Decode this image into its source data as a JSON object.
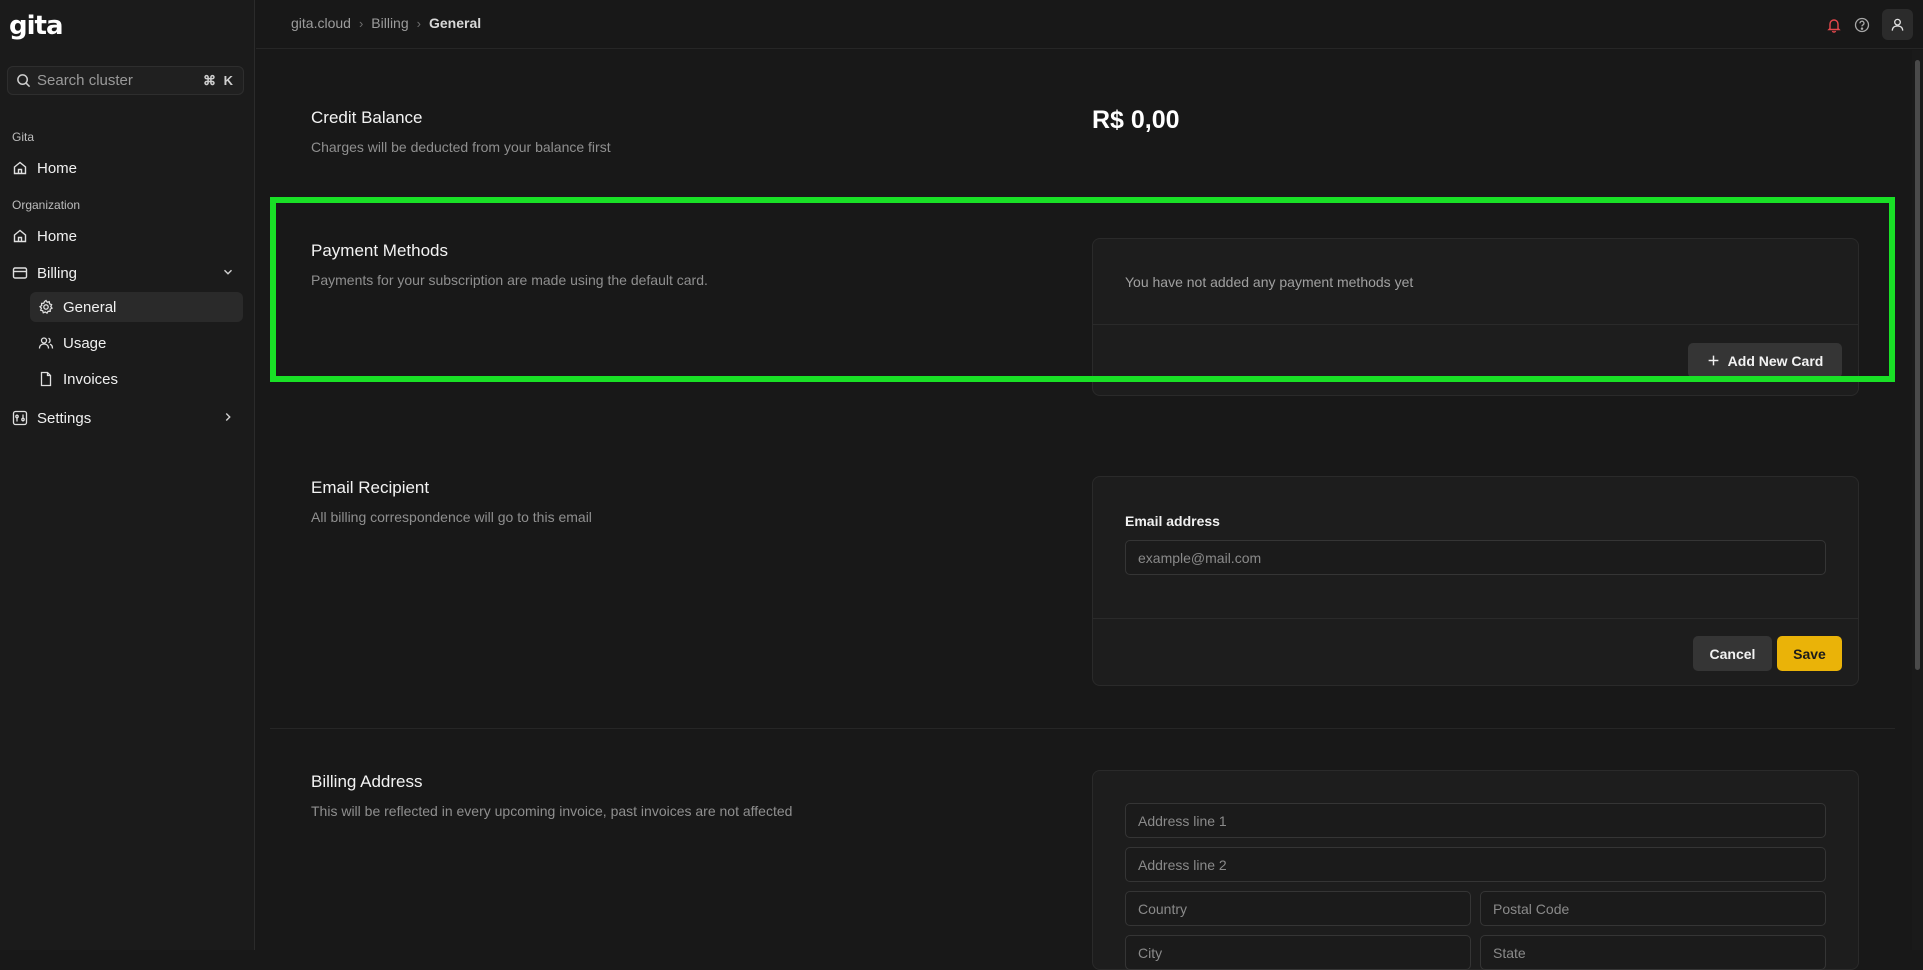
{
  "app": {
    "logo": "gita"
  },
  "sidebar": {
    "search": {
      "placeholder": "Search cluster",
      "shortcut": "⌘ K"
    },
    "sections": [
      {
        "label": "Gita"
      },
      {
        "label": "Organization"
      }
    ],
    "items": [
      {
        "label": "Home",
        "icon": "home-icon"
      },
      {
        "label": "Home",
        "icon": "home-icon"
      },
      {
        "label": "Billing",
        "icon": "credit-card-icon",
        "expanded": true
      },
      {
        "label": "General",
        "icon": "gear-icon",
        "active": true
      },
      {
        "label": "Usage",
        "icon": "users-icon"
      },
      {
        "label": "Invoices",
        "icon": "file-icon"
      },
      {
        "label": "Settings",
        "icon": "settings-panel-icon"
      }
    ]
  },
  "header": {
    "breadcrumb": [
      "gita.cloud",
      "Billing",
      "General"
    ],
    "icons": [
      "bell-icon",
      "help-icon",
      "user-icon"
    ]
  },
  "credit_balance": {
    "title": "Credit Balance",
    "description": "Charges will be deducted from your balance first",
    "amount": "R$ 0,00"
  },
  "payment_methods": {
    "title": "Payment Methods",
    "description": "Payments for your subscription are made using the default card.",
    "empty_message": "You have not added any payment methods yet",
    "add_button": "Add New Card"
  },
  "email_recipient": {
    "title": "Email Recipient",
    "description": "All billing correspondence will go to this email",
    "field_label": "Email address",
    "placeholder": "example@mail.com",
    "cancel_button": "Cancel",
    "save_button": "Save"
  },
  "billing_address": {
    "title": "Billing Address",
    "description": "This will be reflected in every upcoming invoice, past invoices are not affected",
    "address_line_1_placeholder": "Address line 1",
    "address_line_2_placeholder": "Address line 2",
    "country_placeholder": "Country",
    "postal_code_placeholder": "Postal Code",
    "city_placeholder": "City",
    "state_placeholder": "State"
  },
  "colors": {
    "accent": "#eab308",
    "highlight": "#19e026",
    "notification": "#e5484d",
    "background": "#181818"
  }
}
